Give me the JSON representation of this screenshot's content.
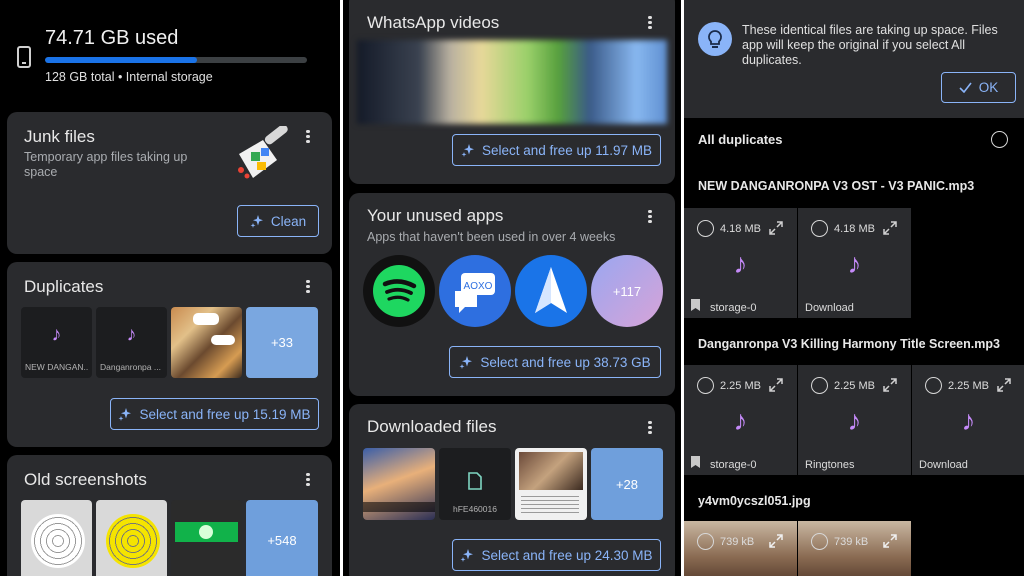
{
  "storage": {
    "used": "74.71 GB used",
    "detail": "128 GB total • Internal storage",
    "used_fraction": 0.58
  },
  "junk": {
    "title": "Junk files",
    "subtitle": "Temporary app files taking up space",
    "button": "Clean"
  },
  "duplicates": {
    "title": "Duplicates",
    "thumbs": [
      "NEW DANGAN...",
      "Danganronpa ..."
    ],
    "more": "+33",
    "button": "Select and free up 15.19 MB"
  },
  "screenshots": {
    "title": "Old screenshots",
    "more": "+548"
  },
  "whatsapp": {
    "title": "WhatsApp videos",
    "button": "Select and free up 11.97 MB"
  },
  "unused": {
    "title": "Your unused apps",
    "subtitle": "Apps that haven't been used in over 4 weeks",
    "more": "+117",
    "button": "Select and free up 38.73 GB"
  },
  "downloaded": {
    "title": "Downloaded files",
    "file_caption": "hFE460016",
    "more": "+28",
    "button": "Select and free up 24.30 MB"
  },
  "tip": {
    "text": "These identical files are taking up space. Files app will keep the original if you select All duplicates.",
    "ok": "OK"
  },
  "dup_list": {
    "all_label": "All duplicates",
    "groups": [
      {
        "name": "NEW DANGANRONPA V3 OST - V3 PANIC.mp3",
        "files": [
          {
            "size": "4.18 MB",
            "folder": "storage-0"
          },
          {
            "size": "4.18 MB",
            "folder": "Download"
          }
        ]
      },
      {
        "name": "Danganronpa V3 Killing Harmony Title Screen.mp3",
        "files": [
          {
            "size": "2.25 MB",
            "folder": "storage-0"
          },
          {
            "size": "2.25 MB",
            "folder": "Ringtones"
          },
          {
            "size": "2.25 MB",
            "folder": "Download"
          }
        ]
      },
      {
        "name": "y4vm0ycszl051.jpg",
        "files": [
          {
            "size": "739 kB"
          },
          {
            "size": "739 kB"
          }
        ]
      }
    ]
  },
  "colors": {
    "accent": "#8ab4f8",
    "card": "#2a2b2e",
    "music": "#c58af9",
    "bar_fill": "#1a73e8"
  }
}
